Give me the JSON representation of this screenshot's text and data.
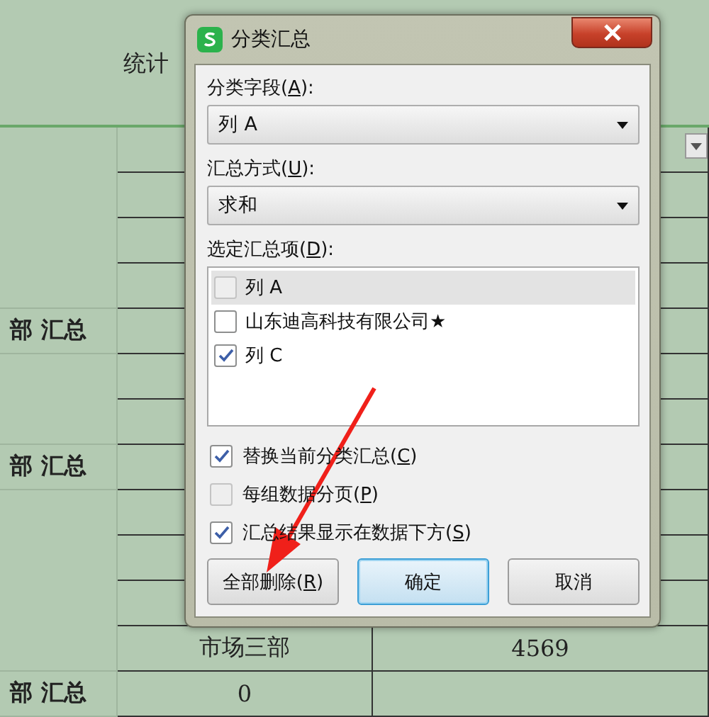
{
  "sheet": {
    "header_sub": "统计",
    "group_labels": [
      "部  汇总",
      "部  汇总",
      "部  汇总"
    ],
    "rows": [
      {
        "column_2": "市场三部",
        "column_3": "4569"
      },
      {
        "column_2": "0"
      }
    ]
  },
  "dialog": {
    "title": "分类汇总",
    "field": {
      "label": "分类字段(",
      "mnemonic": "A",
      "label_end": "):",
      "value": "列 A"
    },
    "method": {
      "label": "汇总方式(",
      "mnemonic": "U",
      "label_end": "):",
      "value": "求和"
    },
    "items_label": {
      "label": "选定汇总项(",
      "mnemonic": "D",
      "label_end": "):"
    },
    "items": [
      {
        "label": "列 A",
        "checked": false,
        "selected": true
      },
      {
        "label": "山东迪高科技有限公司★",
        "checked": false,
        "selected": false
      },
      {
        "label": "列 C",
        "checked": true,
        "selected": false
      }
    ],
    "options": [
      {
        "label": "替换当前分类汇总(",
        "mnemonic": "C",
        "label_end": ")",
        "checked": true
      },
      {
        "label": "每组数据分页(",
        "mnemonic": "P",
        "label_end": ")",
        "checked": false
      },
      {
        "label": "汇总结果显示在数据下方(",
        "mnemonic": "S",
        "label_end": ")",
        "checked": true
      }
    ],
    "buttons": [
      {
        "label": "全部删除(",
        "mnemonic": "R",
        "label_end": ")",
        "default": false
      },
      {
        "label": "确定",
        "default": true
      },
      {
        "label": "取消",
        "default": false
      }
    ]
  }
}
